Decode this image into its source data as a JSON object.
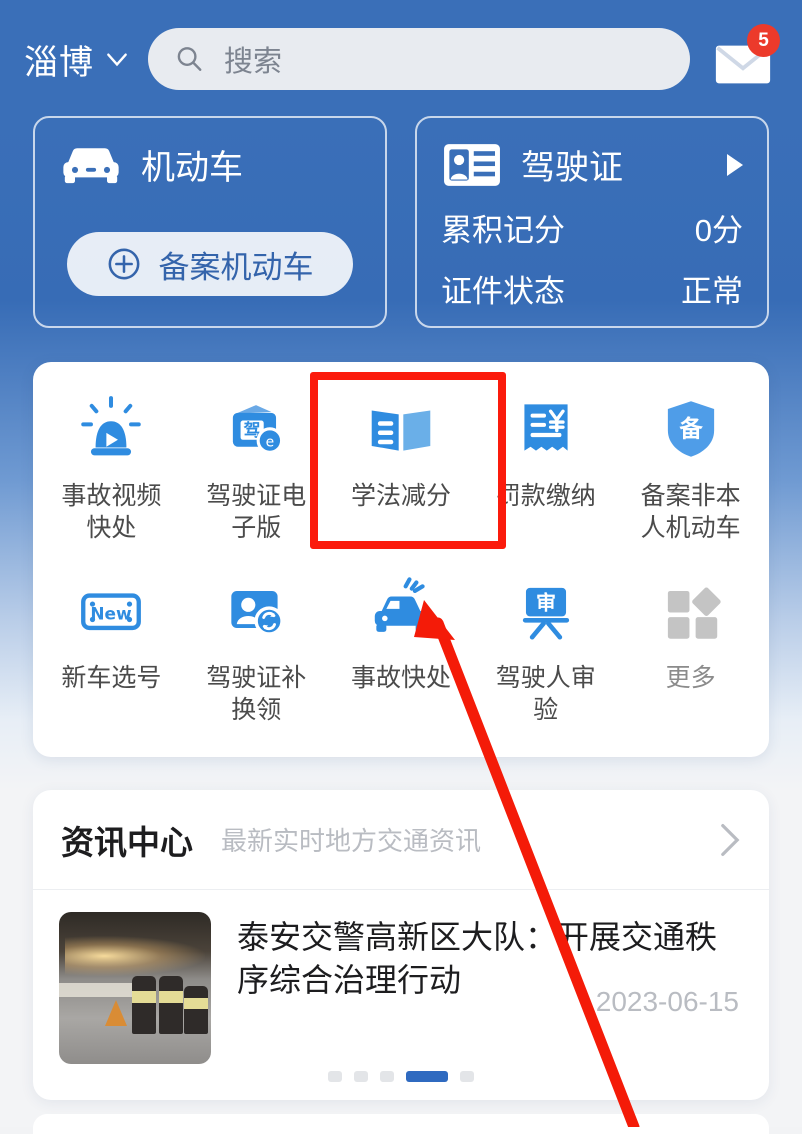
{
  "header": {
    "city": "淄博",
    "city_chevron_icon": "chevron-down-icon",
    "search_icon": "search-icon",
    "search_placeholder": "搜索",
    "search_value": "",
    "mail_icon": "mail-icon",
    "mail_badge": "5"
  },
  "vehicle_card": {
    "icon": "car-icon",
    "title": "机动车",
    "button_icon": "plus-circle-icon",
    "button_label": "备案机动车"
  },
  "license_card": {
    "icon": "id-card-icon",
    "title": "驾驶证",
    "arrow_icon": "play-arrow-icon",
    "rows": [
      {
        "label": "累积记分",
        "value": "0分"
      },
      {
        "label": "证件状态",
        "value": "正常"
      }
    ]
  },
  "services": {
    "row1": [
      {
        "label": "事故视频\n快处",
        "icon": "siren-play-icon"
      },
      {
        "label": "驾驶证电\n子版",
        "icon": "wallet-license-icon"
      },
      {
        "label": "学法减分",
        "icon": "open-book-icon"
      },
      {
        "label": "罚款缴纳",
        "icon": "receipt-yuan-icon"
      },
      {
        "label": "备案非本\n人机动车",
        "icon": "shield-bei-icon"
      }
    ],
    "row2": [
      {
        "label": "新车选号",
        "icon": "plate-new-icon"
      },
      {
        "label": "驾驶证补\n换领",
        "icon": "person-refresh-icon"
      },
      {
        "label": "事故快处",
        "icon": "crash-car-icon"
      },
      {
        "label": "驾驶人审验",
        "icon": "shen-board-icon"
      },
      {
        "label": "更多",
        "icon": "more-grid-icon"
      }
    ]
  },
  "news": {
    "title": "资讯中心",
    "subtitle": "最新实时地方交通资讯",
    "chevron_icon": "chevron-right-icon",
    "item": {
      "thumbnail": "night-road-officers-photo",
      "headline": "泰安交警高新区大队：开展交通秩序综合治理行动",
      "date": "2023-06-15"
    },
    "pagination": {
      "count": 5,
      "active_index": 3
    }
  },
  "annotations": {
    "highlight_box": {
      "target": "学法减分",
      "color": "#fb1b0c"
    },
    "arrow": {
      "target": "事故快处",
      "color": "#f41b08"
    }
  },
  "colors": {
    "header_blue": "#3a6fb8",
    "accent_blue": "#2f6ac0",
    "badge_red": "#ec3a2b",
    "annotation_red": "#fb1b0c"
  }
}
